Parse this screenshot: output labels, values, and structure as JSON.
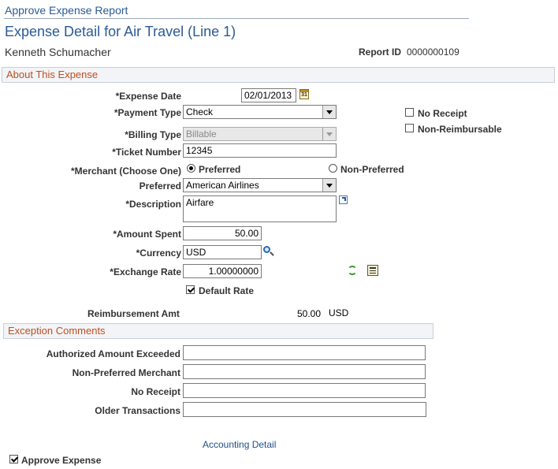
{
  "header": {
    "breadcrumb": "Approve Expense Report",
    "title": "Expense Detail for Air Travel (Line 1)",
    "employee": "Kenneth Schumacher",
    "report_id_label": "Report ID",
    "report_id_value": "0000000109"
  },
  "about": {
    "section_title": "About This Expense",
    "expense_date_label": "*Expense Date",
    "expense_date_value": "02/01/2013",
    "calendar_glyph": "31",
    "payment_type_label": "*Payment Type",
    "payment_type_value": "Check",
    "no_receipt_label": "No Receipt",
    "no_receipt_checked": false,
    "non_reimbursable_label": "Non-Reimbursable",
    "non_reimbursable_checked": false,
    "billing_type_label": "*Billing Type",
    "billing_type_value": "Billable",
    "ticket_number_label": "*Ticket Number",
    "ticket_number_value": "12345",
    "merchant_label": "*Merchant (Choose One)",
    "merchant_preferred_label": "Preferred",
    "merchant_nonpreferred_label": "Non-Preferred",
    "merchant_selected": "Preferred",
    "preferred_label": "Preferred",
    "preferred_value": "American Airlines",
    "description_label": "*Description",
    "description_value": "Airfare",
    "amount_spent_label": "*Amount Spent",
    "amount_spent_value": "50.00",
    "currency_label": "*Currency",
    "currency_value": "USD",
    "exchange_rate_label": "*Exchange Rate",
    "exchange_rate_value": "1.00000000",
    "default_rate_label": "Default Rate",
    "default_rate_checked": true,
    "reimbursement_label": "Reimbursement Amt",
    "reimbursement_value": "50.00",
    "reimbursement_currency": "USD"
  },
  "exceptions": {
    "section_title": "Exception Comments",
    "authorized_label": "Authorized Amount Exceeded",
    "authorized_value": "",
    "nonpreferred_label": "Non-Preferred Merchant",
    "nonpreferred_value": "",
    "noreceipt_label": "No Receipt",
    "noreceipt_value": "",
    "older_label": "Older Transactions",
    "older_value": ""
  },
  "footer": {
    "accounting_link": "Accounting Detail",
    "approve_label": "Approve Expense",
    "approve_checked": true
  },
  "colors": {
    "title_blue": "#2a5a96",
    "section_orange": "#c0501f",
    "link_blue": "#1f4e8c"
  },
  "icons": [
    "calendar-icon",
    "dropdown-arrow-icon",
    "expand-icon",
    "search-icon",
    "refresh-icon",
    "calculator-icon"
  ]
}
